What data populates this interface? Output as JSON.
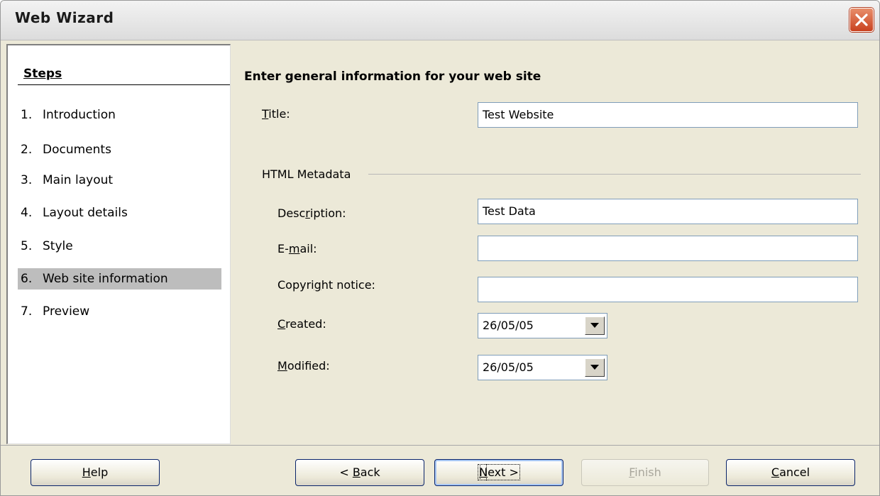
{
  "window": {
    "title": "Web Wizard"
  },
  "steps": {
    "heading": "Steps",
    "items": [
      {
        "num": "1.",
        "label": "Introduction"
      },
      {
        "num": "2.",
        "label": "Documents"
      },
      {
        "num": "3.",
        "label": "Main layout"
      },
      {
        "num": "4.",
        "label": "Layout details"
      },
      {
        "num": "5.",
        "label": "Style"
      },
      {
        "num": "6.",
        "label": "Web site information"
      },
      {
        "num": "7.",
        "label": "Preview"
      }
    ],
    "active_index": 5
  },
  "main": {
    "heading": "Enter general information for your web site",
    "title_label": {
      "pre": "",
      "key": "T",
      "post": "itle:"
    },
    "title_value": "Test Website",
    "metadata_group": "HTML Metadata",
    "description_label": {
      "pre": "Desc",
      "key": "r",
      "post": "iption:"
    },
    "description_value": "Test Data",
    "email_label": {
      "pre": "E-",
      "key": "m",
      "post": "ail:"
    },
    "email_value": "",
    "copyright_label": {
      "pre": "Copyri",
      "key": "g",
      "post": "ht notice:"
    },
    "copyright_value": "",
    "created_label": {
      "pre": "",
      "key": "C",
      "post": "reated:"
    },
    "created_value": "26/05/05",
    "modified_label": {
      "pre": "",
      "key": "M",
      "post": "odified:"
    },
    "modified_value": "26/05/05"
  },
  "footer": {
    "help": {
      "pre": "",
      "key": "H",
      "post": "elp"
    },
    "back": {
      "pre": "< ",
      "key": "B",
      "post": "ack"
    },
    "next": {
      "pre": "",
      "key": "N",
      "post": "ext >"
    },
    "finish": {
      "pre": "",
      "key": "F",
      "post": "inish"
    },
    "cancel": {
      "pre": "",
      "key": "C",
      "post": "ancel"
    }
  },
  "colors": {
    "close_button": "#d4532c",
    "active_step": "#bdbdbd",
    "dialog_bg": "#ece9d8"
  },
  "icons": {
    "close": "close-icon",
    "dropdown": "chevron-down-icon"
  }
}
